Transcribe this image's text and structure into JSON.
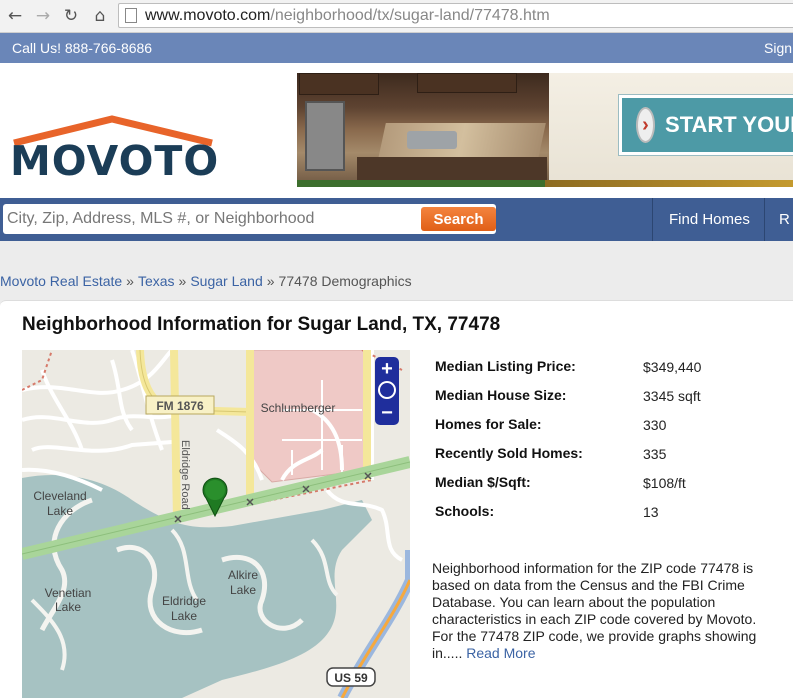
{
  "browser": {
    "url_host": "www.movoto.com",
    "url_path": "/neighborhood/tx/sugar-land/77478.htm"
  },
  "topbar": {
    "call_text": "Call Us! 888-766-8686",
    "sign_in": "Sign"
  },
  "header": {
    "logo_text": "MOVOTO",
    "banner_cta": "START YOUR"
  },
  "search": {
    "placeholder": "City, Zip, Address, MLS #, or Neighborhood",
    "button_label": "Search"
  },
  "nav": {
    "items": [
      "Find Homes",
      "R"
    ]
  },
  "breadcrumb": {
    "items": [
      "Movoto Real Estate",
      "Texas",
      "Sugar Land"
    ],
    "current": "77478 Demographics",
    "separator": "»"
  },
  "page": {
    "title": "Neighborhood Information for Sugar Land, TX, 77478"
  },
  "map": {
    "labels": {
      "fm1876": "FM 1876",
      "schlumberger": "Schlumberger",
      "eldridge_road": "Eldridge Road",
      "cleveland_lake_1": "Cleveland",
      "cleveland_lake_2": "Lake",
      "venetian_lake_1": "Venetian",
      "venetian_lake_2": "Lake",
      "eldridge_lake_1": "Eldridge",
      "eldridge_lake_2": "Lake",
      "alkire_lake_1": "Alkire",
      "alkire_lake_2": "Lake",
      "us59": "US 59"
    },
    "zoom_in": "+",
    "zoom_out": "−"
  },
  "stats": [
    {
      "label": "Median Listing Price:",
      "value": "$349,440"
    },
    {
      "label": "Median House Size:",
      "value": "3345 sqft"
    },
    {
      "label": "Homes for Sale:",
      "value": "330"
    },
    {
      "label": "Recently Sold Homes:",
      "value": "335"
    },
    {
      "label": "Median $/Sqft:",
      "value": "$108/ft"
    },
    {
      "label": "Schools:",
      "value": "13"
    }
  ],
  "description": {
    "text": "Neighborhood information for the ZIP code 77478 is based on data from the Census and the FBI Crime Database. You can learn about the population characteristics in each ZIP code covered by Movoto. For the 77478 ZIP code, we provide graphs showing in.....",
    "link": "Read More"
  },
  "colors": {
    "topbar": "#6a86b8",
    "searchbar": "#3f5e94",
    "search_button": "#e8692a",
    "logo_roof": "#e8642a",
    "logo_text": "#1b3d57",
    "link": "#3b63a4"
  }
}
